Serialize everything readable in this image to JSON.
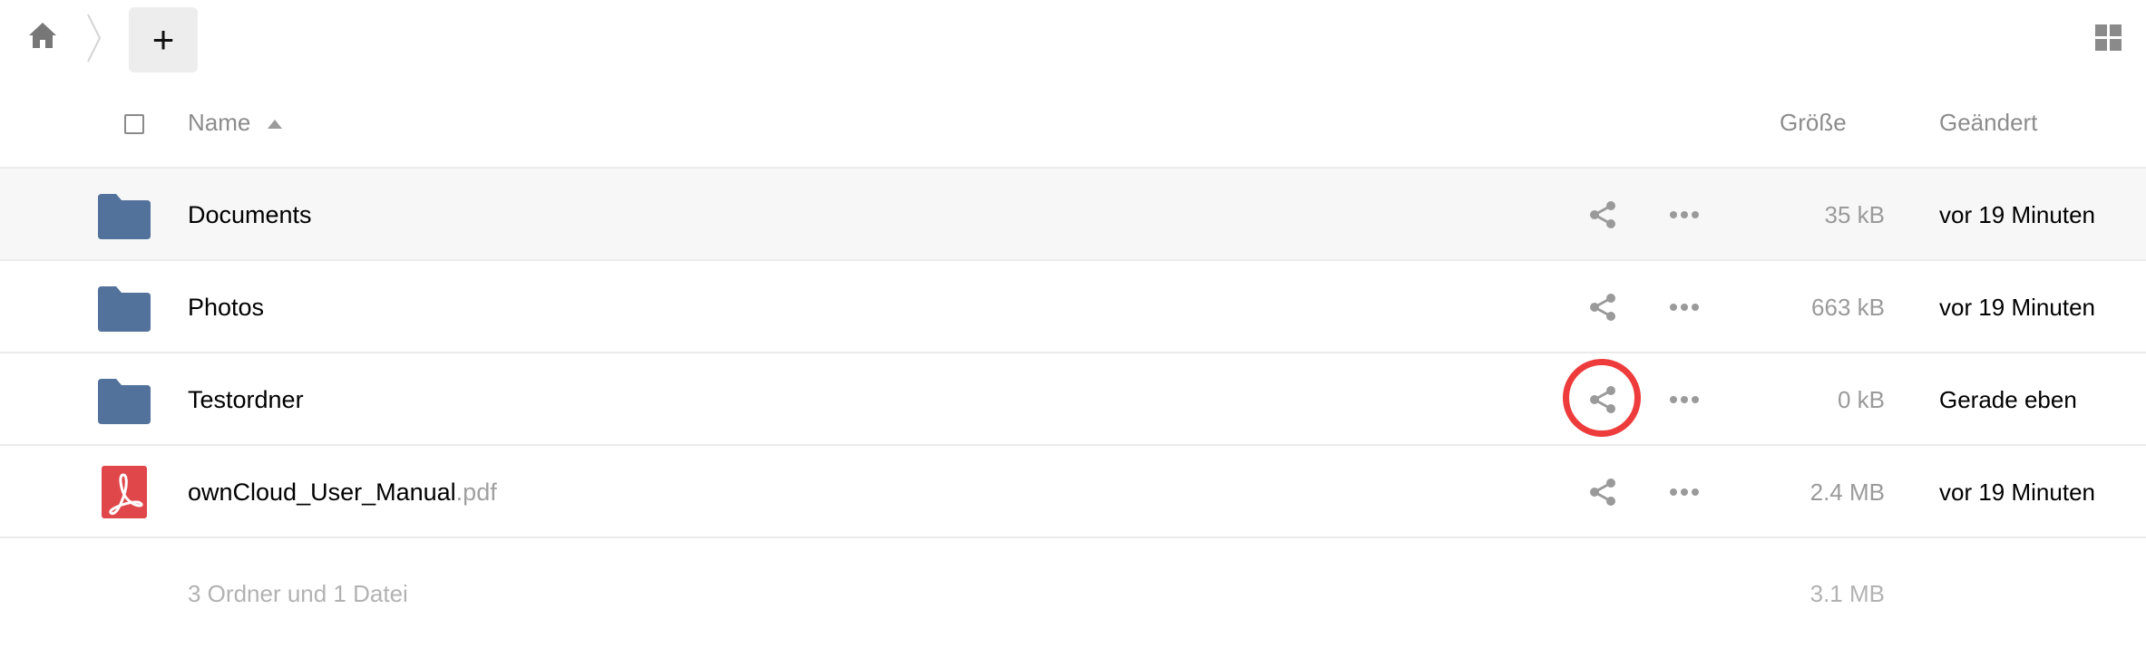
{
  "toolbar": {
    "home_icon": "home-icon",
    "add_label": "+",
    "view_icon": "grid-view-icon"
  },
  "columns": {
    "name": "Name",
    "size": "Größe",
    "modified": "Geändert"
  },
  "files": [
    {
      "name": "Documents",
      "ext": "",
      "type": "folder",
      "size": "35 kB",
      "modified": "vor 19 Minuten"
    },
    {
      "name": "Photos",
      "ext": "",
      "type": "folder",
      "size": "663 kB",
      "modified": "vor 19 Minuten"
    },
    {
      "name": "Testordner",
      "ext": "",
      "type": "folder",
      "size": "0 kB",
      "modified": "Gerade eben"
    },
    {
      "name": "ownCloud_User_Manual",
      "ext": ".pdf",
      "type": "pdf",
      "size": "2.4 MB",
      "modified": "vor 19 Minuten"
    }
  ],
  "summary": {
    "text": "3 Ordner und 1 Datei",
    "size": "3.1 MB"
  },
  "colors": {
    "folder": "#52719b",
    "pdf": "#e0474a",
    "highlight": "#ee3b3b",
    "hover_row": "#f7f7f7"
  }
}
